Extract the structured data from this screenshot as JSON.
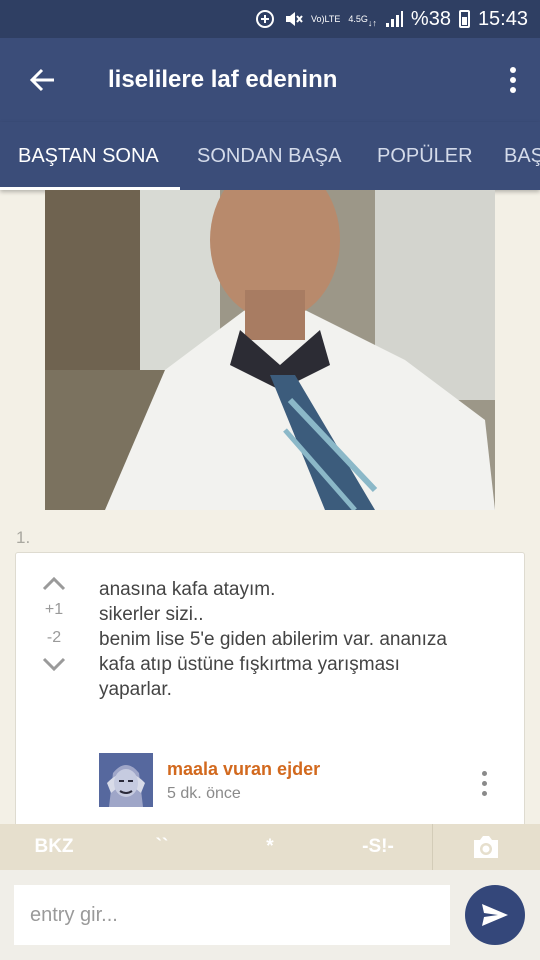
{
  "status_bar": {
    "battery_percent": "%38",
    "time": "15:43",
    "network_label": "4.5G",
    "volte_label": "LTE"
  },
  "app_bar": {
    "title": "liselilere laf edeninn"
  },
  "tabs": [
    {
      "label": "BAŞTAN SONA",
      "active": true
    },
    {
      "label": "SONDAN BAŞA",
      "active": false
    },
    {
      "label": "POPÜLER",
      "active": false
    },
    {
      "label": "BAŞ",
      "active": false
    }
  ],
  "entry": {
    "number": "1.",
    "upvotes": "+1",
    "downvotes": "-2",
    "text_lines": [
      "anasına kafa atayım.",
      "sikerler sizi..",
      "benim lise 5'e giden abilerim var. ananıza",
      "kafa atıp üstüne fışkırtma yarışması",
      "yaparlar."
    ],
    "author": "maala vuran ejder",
    "time": "5 dk. önce"
  },
  "editor_toolbar": {
    "buttons": [
      "BKZ",
      "``",
      "*",
      "-S!-"
    ]
  },
  "input": {
    "placeholder": "entry gir..."
  },
  "colors": {
    "primary": "#3b4d79",
    "status_bar": "#2f3f63",
    "author": "#d2691e",
    "background": "#f3f0e6"
  }
}
